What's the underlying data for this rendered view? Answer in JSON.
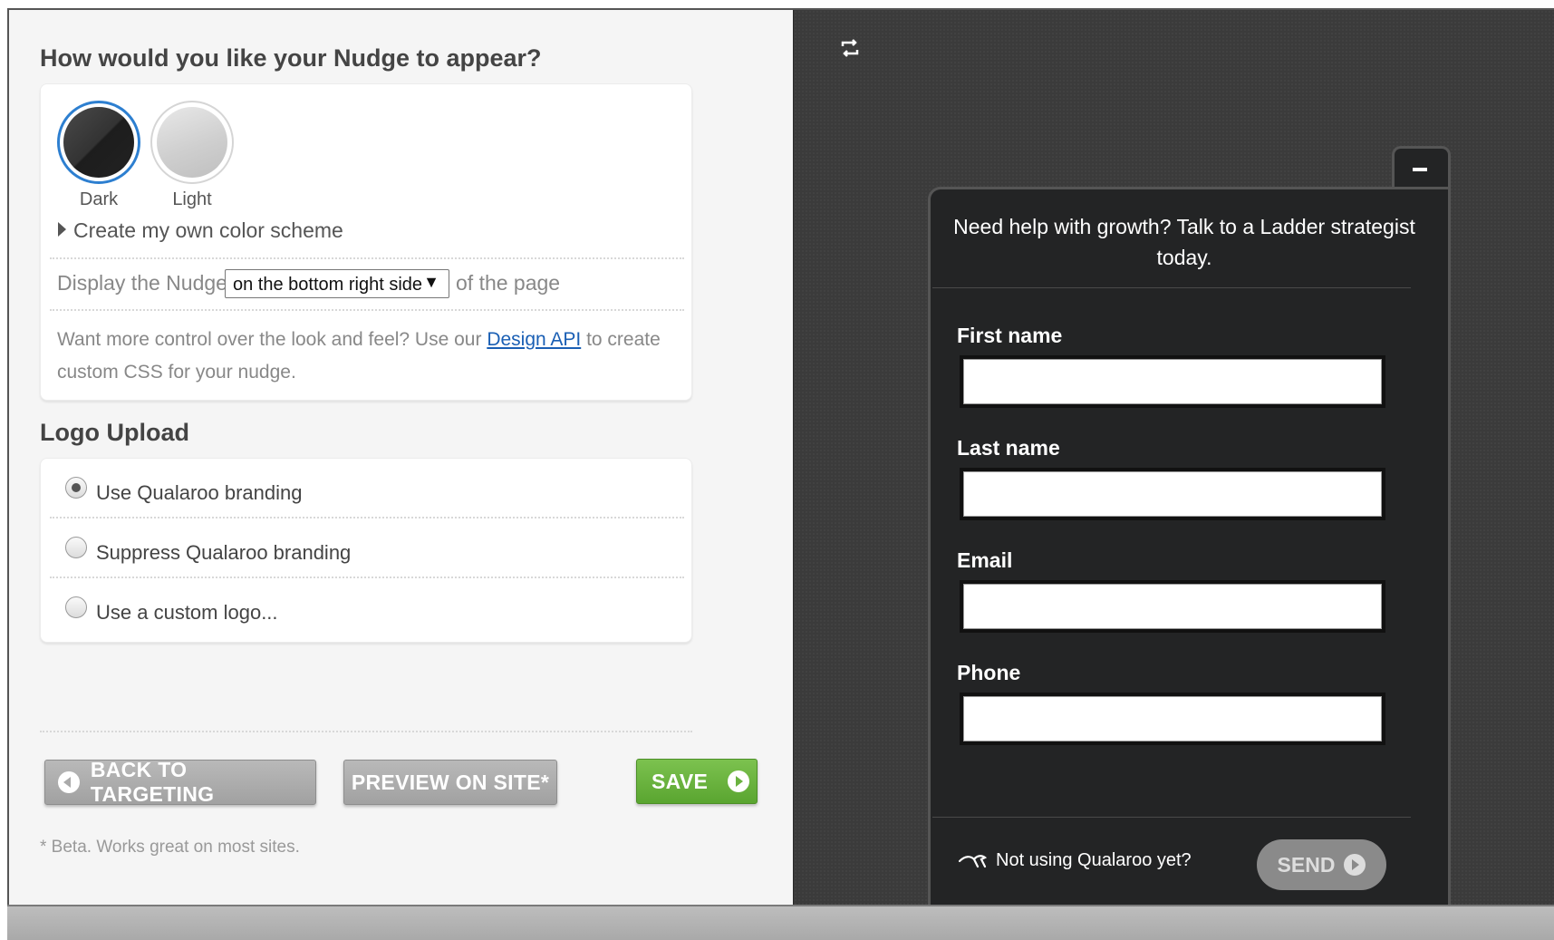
{
  "appearance": {
    "title": "How would you like your Nudge to appear?",
    "themes": [
      {
        "label": "Dark",
        "selected": true
      },
      {
        "label": "Light",
        "selected": false
      }
    ],
    "custom_scheme_label": "Create my own color scheme",
    "display_prefix": "Display the Nudge",
    "position_select_value": "on the bottom right side",
    "display_suffix": "of the page",
    "design_api_text_before": "Want more control over the look and feel? Use our",
    "design_api_link": "Design API",
    "design_api_text_after": "to create",
    "design_api_text_line2": "custom CSS for your nudge."
  },
  "logo_upload": {
    "title": "Logo Upload",
    "options": [
      {
        "label": "Use Qualaroo branding",
        "checked": true
      },
      {
        "label": "Suppress Qualaroo branding",
        "checked": false
      },
      {
        "label": "Use a custom logo...",
        "checked": false
      }
    ]
  },
  "actions": {
    "back_label": "BACK TO TARGETING",
    "preview_label": "PREVIEW ON SITE*",
    "save_label": "SAVE",
    "footnote": "* Beta. Works great on most sites."
  },
  "preview": {
    "minimize_label": "-",
    "question": "Need help with growth? Talk to a Ladder strategist today.",
    "fields": [
      "First name",
      "Last name",
      "Email",
      "Phone"
    ],
    "footer_text": "Not using Qualaroo yet?",
    "send_label": "SEND"
  },
  "colors": {
    "selected_ring": "#2d7fd0",
    "save_green": "#6ab240",
    "nudge_bg": "#232425",
    "link_blue": "#1a5fb4"
  }
}
